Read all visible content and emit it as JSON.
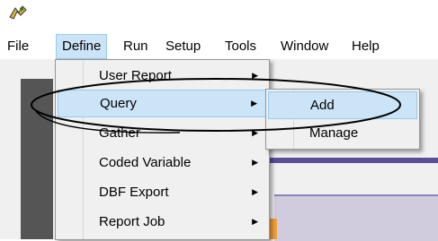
{
  "menubar": {
    "items": [
      {
        "label": "File"
      },
      {
        "label": "Define"
      },
      {
        "label": "Run"
      },
      {
        "label": "Setup"
      },
      {
        "label": "Tools"
      },
      {
        "label": "Window"
      },
      {
        "label": "Help"
      }
    ]
  },
  "define_menu": {
    "items": [
      {
        "label": "User Report",
        "has_submenu": true
      },
      {
        "label": "Query",
        "has_submenu": true,
        "highlighted": true
      },
      {
        "label": "Gather",
        "has_submenu": true
      },
      {
        "label": "Coded Variable",
        "has_submenu": true
      },
      {
        "label": "DBF Export",
        "has_submenu": true
      },
      {
        "label": "Report Job",
        "has_submenu": true
      }
    ],
    "arrow_glyph": "▶"
  },
  "query_submenu": {
    "items": [
      {
        "label": "Add",
        "highlighted": true
      },
      {
        "label": "Manage"
      }
    ]
  },
  "colors": {
    "highlight": "#cce4f7",
    "menu_bg": "#f0f0f0",
    "annotation": "#000000"
  }
}
